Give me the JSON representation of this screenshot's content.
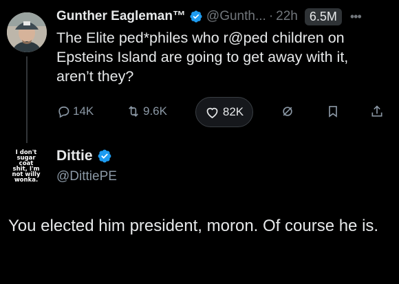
{
  "tweet": {
    "author_name": "Gunther Eagleman™",
    "handle": "@Gunth...",
    "separator": "·",
    "time": "22h",
    "views": "6.5M",
    "more": "•••",
    "text": "The Elite ped*philes who r@ped children on Epsteins Island are going to get away with it, aren’t they?",
    "actions": {
      "replies": "14K",
      "reposts": "9.6K",
      "likes": "82K"
    }
  },
  "reply": {
    "author_name": "Dittie",
    "handle": "@DittiePE",
    "avatar_text": "I don't\nsugar\ncoat\nshit, I'm\nnot willy\nwonka.",
    "text": "You elected him president, moron. Of course he is."
  },
  "colors": {
    "background": "#000000",
    "text": "#e7e9ea",
    "secondary": "#71767b",
    "verified": "#1d9bf0"
  }
}
